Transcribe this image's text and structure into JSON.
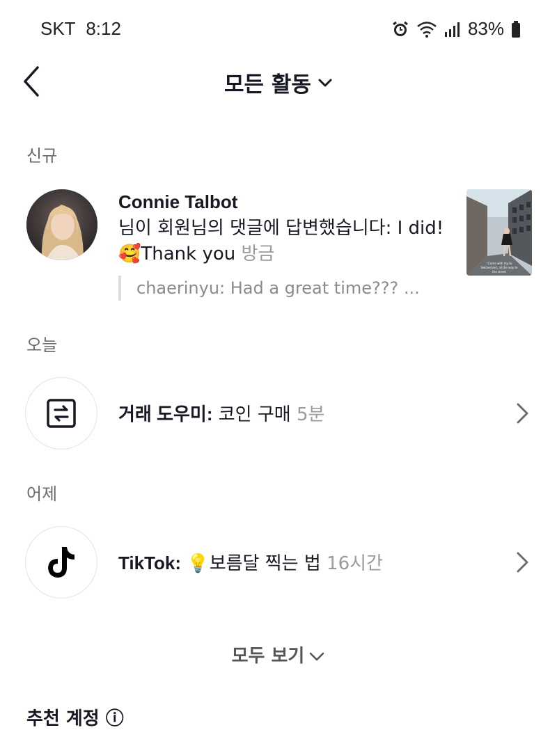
{
  "status_bar": {
    "carrier": "SKT",
    "time": "8:12",
    "battery": "83%",
    "icons": [
      "alarm-icon",
      "wifi-icon",
      "signal-icon",
      "battery-icon"
    ]
  },
  "header": {
    "title": "모든 활동",
    "back_icon": "chevron-left-icon",
    "dropdown_icon": "chevron-down-icon"
  },
  "sections": {
    "new": {
      "label": "신규"
    },
    "today": {
      "label": "오늘"
    },
    "yesterday": {
      "label": "어제"
    }
  },
  "new_notification": {
    "user_name": "Connie Talbot",
    "message_before_emoji": "님이 회원님의 댓글에 답변했습니다: I did! ",
    "emoji": "🥰",
    "message_after_emoji": "Thank you",
    "time": "방금",
    "quoted_comment": "chaerinyu: Had a great time??? ...",
    "thumbnail_caption": "I Came with my to Switzerland, all the way to the street"
  },
  "today_notification": {
    "name": "거래 도우미:",
    "text": "코인 구매",
    "time": "5분",
    "icon": "exchange-icon"
  },
  "yesterday_notification": {
    "name": "TikTok:",
    "emoji": "💡",
    "text": "보름달 찍는 법",
    "time": "16시간",
    "icon": "tiktok-logo-icon"
  },
  "see_all": {
    "label": "모두 보기"
  },
  "bottom_cut_text": "추천 계정 ⓘ",
  "colors": {
    "text": "#161823",
    "secondary": "#9a9a9a",
    "section": "#6b6b6b",
    "divider": "#e3e3e3"
  }
}
